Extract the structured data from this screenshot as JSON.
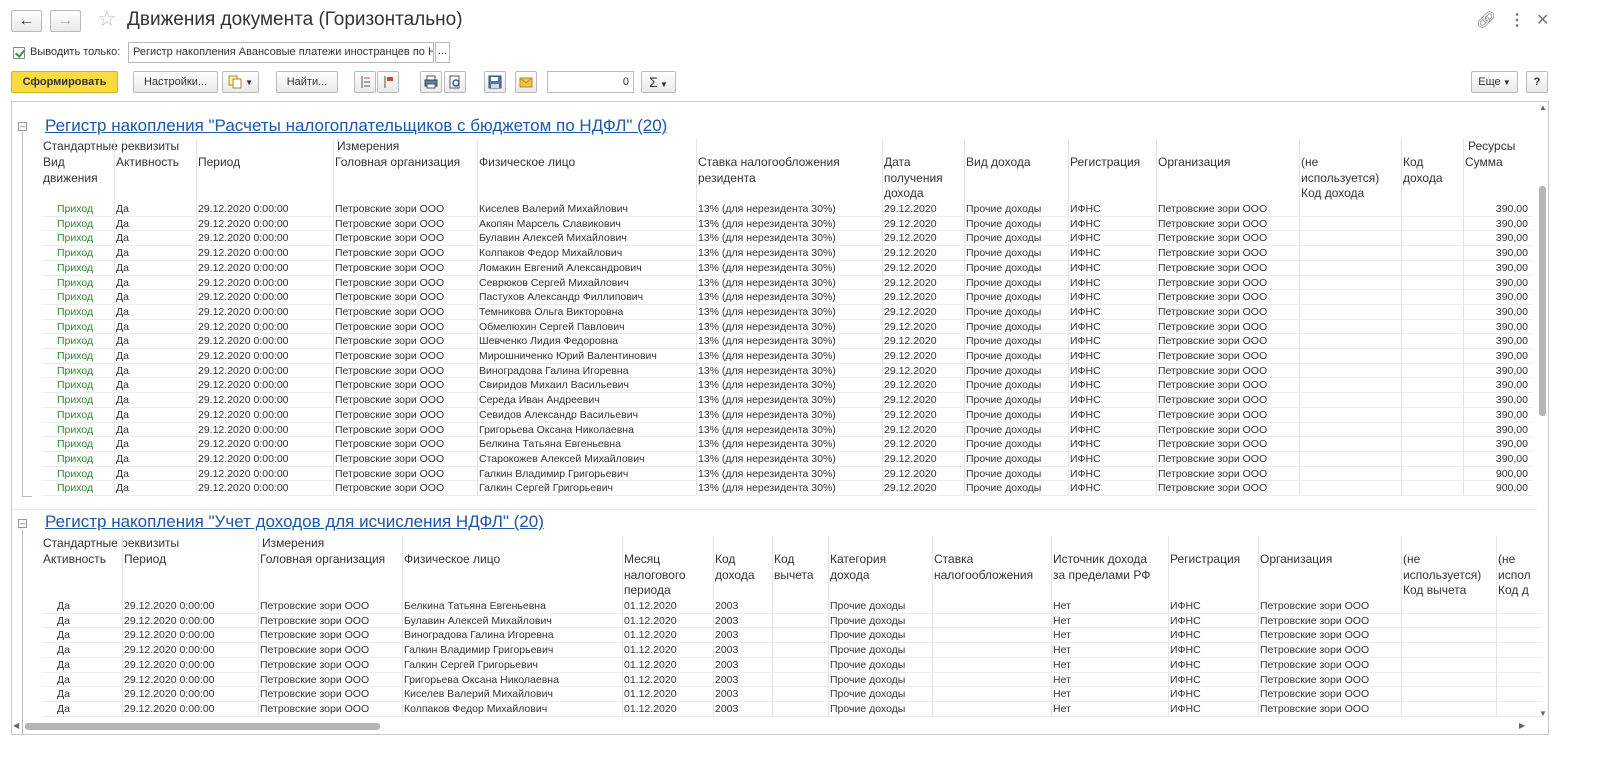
{
  "window": {
    "title": "Движения документа (Горизонтально)",
    "back_icon": "arrow-left-icon",
    "forward_icon": "arrow-right-icon"
  },
  "filter": {
    "checkbox_label": "Выводить только:",
    "checked": true,
    "value": "Регистр накопления Авансовые платежи иностранцев по Н",
    "pick_button": "..."
  },
  "toolbar": {
    "generate": "Сформировать",
    "settings": "Настройки...",
    "find": "Найти...",
    "number_value": "0",
    "sum_symbol": "Σ",
    "more": "Еще",
    "help": "?"
  },
  "section1": {
    "title": "Регистр накопления \"Расчеты налогоплательщиков с бюджетом по НДФЛ\" (20)",
    "groups": {
      "standard": "Стандартные реквизиты",
      "dimensions": "Измерения",
      "resources": "Ресурсы"
    },
    "columns": [
      "Вид\nдвижения",
      "Активность",
      "Период",
      "Головная организация",
      "Физическое лицо",
      "Ставка налогообложения\nрезидента",
      "Дата\nполучения\nдохода",
      "Вид дохода",
      "Регистрация",
      "Организация",
      "(не\nиспользуется)\nКод дохода",
      "Код\nдохода",
      "Сумма"
    ],
    "rows": [
      [
        "Приход",
        "Да",
        "29.12.2020 0:00:00",
        "Петровские зори ООО",
        "Киселев Валерий Михайлович",
        "13% (для нерезидента 30%)",
        "29.12.2020",
        "Прочие доходы",
        "ИФНС",
        "Петровские зори ООО",
        "",
        "",
        "390,00"
      ],
      [
        "Приход",
        "Да",
        "29.12.2020 0:00:00",
        "Петровские зори ООО",
        "Акопян Марсель Славикович",
        "13% (для нерезидента 30%)",
        "29.12.2020",
        "Прочие доходы",
        "ИФНС",
        "Петровские зори ООО",
        "",
        "",
        "390,00"
      ],
      [
        "Приход",
        "Да",
        "29.12.2020 0:00:00",
        "Петровские зори ООО",
        "Булавин Алексей Михайлович",
        "13% (для нерезидента 30%)",
        "29.12.2020",
        "Прочие доходы",
        "ИФНС",
        "Петровские зори ООО",
        "",
        "",
        "390,00"
      ],
      [
        "Приход",
        "Да",
        "29.12.2020 0:00:00",
        "Петровские зори ООО",
        "Колпаков Федор Михайлович",
        "13% (для нерезидента 30%)",
        "29.12.2020",
        "Прочие доходы",
        "ИФНС",
        "Петровские зори ООО",
        "",
        "",
        "390,00"
      ],
      [
        "Приход",
        "Да",
        "29.12.2020 0:00:00",
        "Петровские зори ООО",
        "Ломакин Евгений Александрович",
        "13% (для нерезидента 30%)",
        "29.12.2020",
        "Прочие доходы",
        "ИФНС",
        "Петровские зори ООО",
        "",
        "",
        "390,00"
      ],
      [
        "Приход",
        "Да",
        "29.12.2020 0:00:00",
        "Петровские зори ООО",
        "Севрюков Сергей Михайлович",
        "13% (для нерезидента 30%)",
        "29.12.2020",
        "Прочие доходы",
        "ИФНС",
        "Петровские зори ООО",
        "",
        "",
        "390,00"
      ],
      [
        "Приход",
        "Да",
        "29.12.2020 0:00:00",
        "Петровские зори ООО",
        "Пастухов Александр Филлипович",
        "13% (для нерезидента 30%)",
        "29.12.2020",
        "Прочие доходы",
        "ИФНС",
        "Петровские зори ООО",
        "",
        "",
        "390,00"
      ],
      [
        "Приход",
        "Да",
        "29.12.2020 0:00:00",
        "Петровские зори ООО",
        "Темникова Ольга Викторовна",
        "13% (для нерезидента 30%)",
        "29.12.2020",
        "Прочие доходы",
        "ИФНС",
        "Петровские зори ООО",
        "",
        "",
        "390,00"
      ],
      [
        "Приход",
        "Да",
        "29.12.2020 0:00:00",
        "Петровские зори ООО",
        "Обмелюхин Сергей Павлович",
        "13% (для нерезидента 30%)",
        "29.12.2020",
        "Прочие доходы",
        "ИФНС",
        "Петровские зори ООО",
        "",
        "",
        "390,00"
      ],
      [
        "Приход",
        "Да",
        "29.12.2020 0:00:00",
        "Петровские зори ООО",
        "Шевченко Лидия Федоровна",
        "13% (для нерезидента 30%)",
        "29.12.2020",
        "Прочие доходы",
        "ИФНС",
        "Петровские зори ООО",
        "",
        "",
        "390,00"
      ],
      [
        "Приход",
        "Да",
        "29.12.2020 0:00:00",
        "Петровские зори ООО",
        "Мирошниченко Юрий Валентинович",
        "13% (для нерезидента 30%)",
        "29.12.2020",
        "Прочие доходы",
        "ИФНС",
        "Петровские зори ООО",
        "",
        "",
        "390,00"
      ],
      [
        "Приход",
        "Да",
        "29.12.2020 0:00:00",
        "Петровские зори ООО",
        "Виноградова Галина Игоревна",
        "13% (для нерезидента 30%)",
        "29.12.2020",
        "Прочие доходы",
        "ИФНС",
        "Петровские зори ООО",
        "",
        "",
        "390,00"
      ],
      [
        "Приход",
        "Да",
        "29.12.2020 0:00:00",
        "Петровские зори ООО",
        "Свиридов Михаил Васильевич",
        "13% (для нерезидента 30%)",
        "29.12.2020",
        "Прочие доходы",
        "ИФНС",
        "Петровские зори ООО",
        "",
        "",
        "390,00"
      ],
      [
        "Приход",
        "Да",
        "29.12.2020 0:00:00",
        "Петровские зори ООО",
        "Середа Иван Андреевич",
        "13% (для нерезидента 30%)",
        "29.12.2020",
        "Прочие доходы",
        "ИФНС",
        "Петровские зори ООО",
        "",
        "",
        "390,00"
      ],
      [
        "Приход",
        "Да",
        "29.12.2020 0:00:00",
        "Петровские зори ООО",
        "Севидов Александр Васильевич",
        "13% (для нерезидента 30%)",
        "29.12.2020",
        "Прочие доходы",
        "ИФНС",
        "Петровские зори ООО",
        "",
        "",
        "390,00"
      ],
      [
        "Приход",
        "Да",
        "29.12.2020 0:00:00",
        "Петровские зори ООО",
        "Григорьева Оксана Николаевна",
        "13% (для нерезидента 30%)",
        "29.12.2020",
        "Прочие доходы",
        "ИФНС",
        "Петровские зори ООО",
        "",
        "",
        "390,00"
      ],
      [
        "Приход",
        "Да",
        "29.12.2020 0:00:00",
        "Петровские зори ООО",
        "Белкина Татьяна Евгеньевна",
        "13% (для нерезидента 30%)",
        "29.12.2020",
        "Прочие доходы",
        "ИФНС",
        "Петровские зори ООО",
        "",
        "",
        "390,00"
      ],
      [
        "Приход",
        "Да",
        "29.12.2020 0:00:00",
        "Петровские зори ООО",
        "Старокожев Алексей Михайлович",
        "13% (для нерезидента 30%)",
        "29.12.2020",
        "Прочие доходы",
        "ИФНС",
        "Петровские зори ООО",
        "",
        "",
        "390,00"
      ],
      [
        "Приход",
        "Да",
        "29.12.2020 0:00:00",
        "Петровские зори ООО",
        "Галкин Владимир Григорьевич",
        "13% (для нерезидента 30%)",
        "29.12.2020",
        "Прочие доходы",
        "ИФНС",
        "Петровские зори ООО",
        "",
        "",
        "900,00"
      ],
      [
        "Приход",
        "Да",
        "29.12.2020 0:00:00",
        "Петровские зори ООО",
        "Галкин Сергей Григорьевич",
        "13% (для нерезидента 30%)",
        "29.12.2020",
        "Прочие доходы",
        "ИФНС",
        "Петровские зори ООО",
        "",
        "",
        "900,00"
      ]
    ]
  },
  "section2": {
    "title": "Регистр накопления \"Учет доходов для исчисления НДФЛ\" (20)",
    "groups": {
      "standard": "Стандартные реквизиты",
      "dimensions": "Измерения"
    },
    "columns": [
      "Активность",
      "Период",
      "Головная организация",
      "Физическое лицо",
      "Месяц\nналогового\nпериода",
      "Код\nдохода",
      "Код\nвычета",
      "Категория\nдохода",
      "Ставка\nналогообложения",
      "Источник дохода\nза пределами РФ",
      "Регистрация",
      "Организация",
      "(не\nиспользуется)\nКод вычета",
      "(не\nиспол\nКод д"
    ],
    "rows": [
      [
        "Да",
        "29.12.2020 0:00:00",
        "Петровские зори ООО",
        "Белкина Татьяна Евгеньевна",
        "01.12.2020",
        "2003",
        "",
        "Прочие доходы",
        "",
        "Нет",
        "ИФНС",
        "Петровские зори ООО",
        "",
        ""
      ],
      [
        "Да",
        "29.12.2020 0:00:00",
        "Петровские зори ООО",
        "Булавин Алексей Михайлович",
        "01.12.2020",
        "2003",
        "",
        "Прочие доходы",
        "",
        "Нет",
        "ИФНС",
        "Петровские зори ООО",
        "",
        ""
      ],
      [
        "Да",
        "29.12.2020 0:00:00",
        "Петровские зори ООО",
        "Виноградова Галина Игоревна",
        "01.12.2020",
        "2003",
        "",
        "Прочие доходы",
        "",
        "Нет",
        "ИФНС",
        "Петровские зори ООО",
        "",
        ""
      ],
      [
        "Да",
        "29.12.2020 0:00:00",
        "Петровские зори ООО",
        "Галкин Владимир Григорьевич",
        "01.12.2020",
        "2003",
        "",
        "Прочие доходы",
        "",
        "Нет",
        "ИФНС",
        "Петровские зори ООО",
        "",
        ""
      ],
      [
        "Да",
        "29.12.2020 0:00:00",
        "Петровские зори ООО",
        "Галкин Сергей Григорьевич",
        "01.12.2020",
        "2003",
        "",
        "Прочие доходы",
        "",
        "Нет",
        "ИФНС",
        "Петровские зори ООО",
        "",
        ""
      ],
      [
        "Да",
        "29.12.2020 0:00:00",
        "Петровские зори ООО",
        "Григорьева Оксана Николаевна",
        "01.12.2020",
        "2003",
        "",
        "Прочие доходы",
        "",
        "Нет",
        "ИФНС",
        "Петровские зори ООО",
        "",
        ""
      ],
      [
        "Да",
        "29.12.2020 0:00:00",
        "Петровские зори ООО",
        "Киселев Валерий Михайлович",
        "01.12.2020",
        "2003",
        "",
        "Прочие доходы",
        "",
        "Нет",
        "ИФНС",
        "Петровские зори ООО",
        "",
        ""
      ],
      [
        "Да",
        "29.12.2020 0:00:00",
        "Петровские зори ООО",
        "Колпаков Федор Михайлович",
        "01.12.2020",
        "2003",
        "",
        "Прочие доходы",
        "",
        "Нет",
        "ИФНС",
        "Петровские зори ООО",
        "",
        ""
      ]
    ]
  },
  "colors": {
    "accent_button": "#fbdc40",
    "link": "#1d58a8",
    "movement_green": "#2c8a2c"
  }
}
